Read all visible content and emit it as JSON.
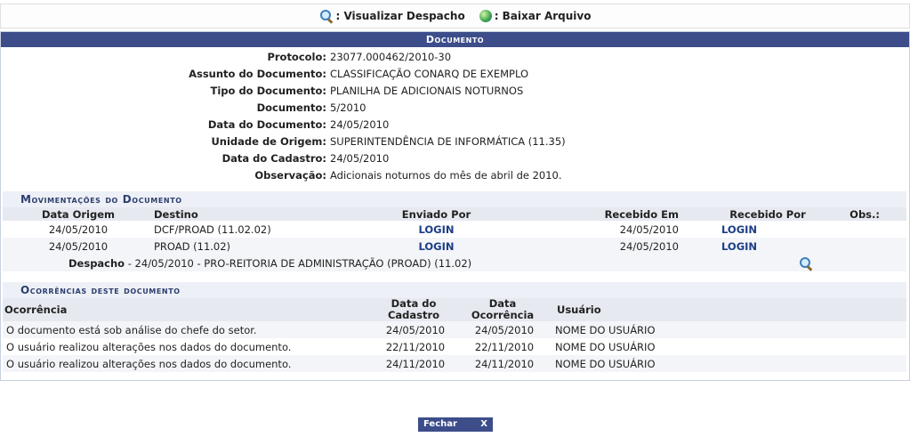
{
  "toolbar": {
    "view_label": ": Visualizar Despacho",
    "download_label": ": Baixar Arquivo"
  },
  "document": {
    "title": "Documento",
    "fields": [
      {
        "label": "Protocolo:",
        "value": "23077.000462/2010-30"
      },
      {
        "label": "Assunto do Documento:",
        "value": "CLASSIFICAÇÃO CONARQ DE EXEMPLO"
      },
      {
        "label": "Tipo do Documento:",
        "value": "PLANILHA DE ADICIONAIS NOTURNOS"
      },
      {
        "label": "Documento:",
        "value": "5/2010"
      },
      {
        "label": "Data do Documento:",
        "value": "24/05/2010"
      },
      {
        "label": "Unidade de Origem:",
        "value": "SUPERINTENDÊNCIA DE INFORMÁTICA (11.35)"
      },
      {
        "label": "Data do Cadastro:",
        "value": "24/05/2010"
      },
      {
        "label": "Observação:",
        "value": "Adicionais noturnos do mês de abril de 2010."
      }
    ]
  },
  "movements": {
    "title": "Movimentações do Documento",
    "headers": [
      "Data Origem",
      "Destino",
      "Enviado Por",
      "Recebido Em",
      "Recebido Por",
      "Obs.:"
    ],
    "rows": [
      {
        "data_origem": "24/05/2010",
        "destino": "DCF/PROAD (11.02.02)",
        "enviado_por": "LOGIN",
        "recebido_em": "24/05/2010",
        "recebido_por": "LOGIN"
      },
      {
        "data_origem": "24/05/2010",
        "destino": "PROAD (11.02)",
        "enviado_por": "LOGIN",
        "recebido_em": "24/05/2010",
        "recebido_por": "LOGIN"
      }
    ],
    "despacho_label": "Despacho",
    "despacho_text": " - 24/05/2010 - PRO-REITORIA DE ADMINISTRAÇÃO (PROAD) (11.02)"
  },
  "occurrences": {
    "title": "Ocorrências deste documento",
    "headers": {
      "ocorrencia": "Ocorrência",
      "data_cadastro_1": "Data do",
      "data_cadastro_2": "Cadastro",
      "data_ocorrencia_1": "Data",
      "data_ocorrencia_2": "Ocorrência",
      "usuario": "Usuário"
    },
    "rows": [
      {
        "ocorrencia": "O documento está sob análise do chefe do setor.",
        "data_cadastro": "24/05/2010",
        "data_ocorrencia": "24/05/2010",
        "usuario": "NOME DO USUÁRIO"
      },
      {
        "ocorrencia": "O usuário realizou alterações nos dados do documento.",
        "data_cadastro": "22/11/2010",
        "data_ocorrencia": "22/11/2010",
        "usuario": "NOME DO USUÁRIO"
      },
      {
        "ocorrencia": "O usuário realizou alterações nos dados do documento.",
        "data_cadastro": "24/11/2010",
        "data_ocorrencia": "24/11/2010",
        "usuario": "NOME DO USUÁRIO"
      }
    ]
  },
  "footer": {
    "close_label": "Fechar",
    "close_x": "X"
  }
}
